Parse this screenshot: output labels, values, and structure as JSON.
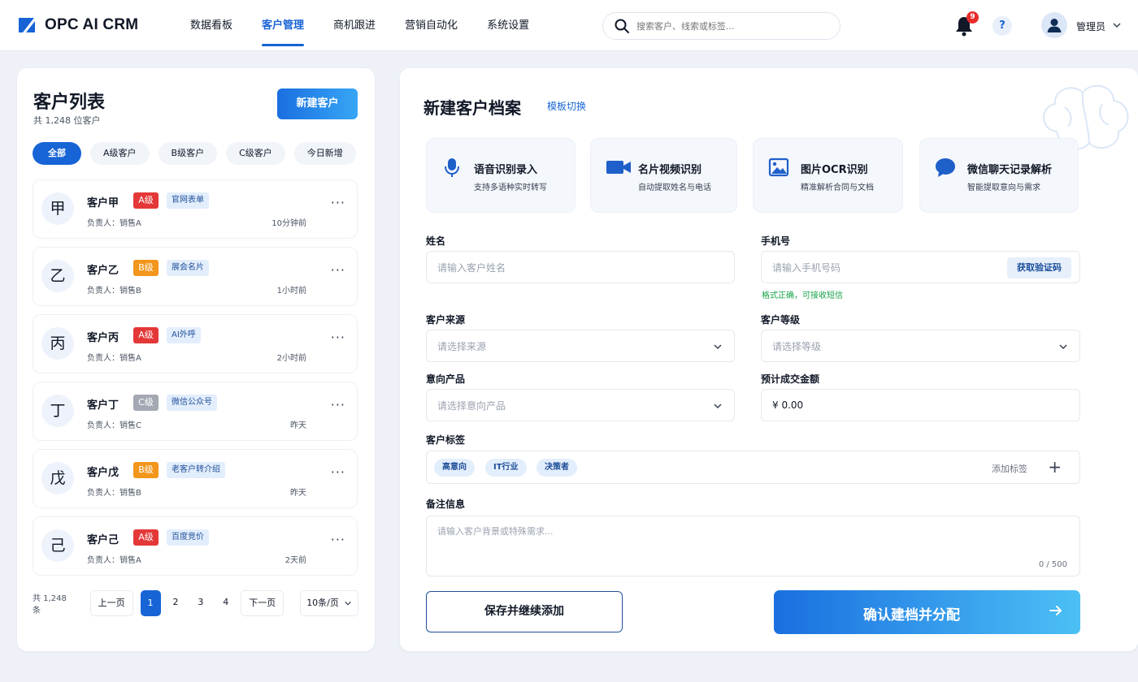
{
  "app": {
    "name": "OPC AI CRM"
  },
  "nav": {
    "items": [
      "数据看板",
      "客户管理",
      "商机跟进",
      "营销自动化",
      "系统设置"
    ],
    "active": 1
  },
  "search": {
    "placeholder": "搜索客户、线索或标签..."
  },
  "notifications": {
    "count": "9"
  },
  "help": {
    "label": "?"
  },
  "user": {
    "name": "管理员"
  },
  "colors": {
    "primary": "#1764d6",
    "level_a": "#e43838",
    "level_b": "#f2961c",
    "level_c": "#a3a8b2",
    "success": "#18a34a"
  },
  "customer_list": {
    "title": "客户列表",
    "subtitle": "共 1,248 位客户",
    "new_button": "新建客户",
    "filters": [
      "全部",
      "A级客户",
      "B级客户",
      "C级客户",
      "今日新增"
    ],
    "active_filter": 0,
    "more_label": "···",
    "items": [
      {
        "avatar": "甲",
        "name": "客户甲",
        "level": "A级",
        "level_key": "a",
        "source": "官网表单",
        "owner": "负责人：销售A",
        "time": "10分钟前"
      },
      {
        "avatar": "乙",
        "name": "客户乙",
        "level": "B级",
        "level_key": "b",
        "source": "展会名片",
        "owner": "负责人：销售B",
        "time": "1小时前"
      },
      {
        "avatar": "丙",
        "name": "客户丙",
        "level": "A级",
        "level_key": "a",
        "source": "AI外呼",
        "owner": "负责人：销售A",
        "time": "2小时前"
      },
      {
        "avatar": "丁",
        "name": "客户丁",
        "level": "C级",
        "level_key": "c",
        "source": "微信公众号",
        "owner": "负责人：销售C",
        "time": "昨天"
      },
      {
        "avatar": "戊",
        "name": "客户戊",
        "level": "B级",
        "level_key": "b",
        "source": "老客户转介绍",
        "owner": "负责人：销售B",
        "time": "昨天"
      },
      {
        "avatar": "己",
        "name": "客户己",
        "level": "A级",
        "level_key": "a",
        "source": "百度竞价",
        "owner": "负责人：销售A",
        "time": "2天前"
      }
    ],
    "pagination": {
      "total": "共 1,248 条",
      "prev": "上一页",
      "pages": [
        "1",
        "2",
        "3",
        "4"
      ],
      "current": "1",
      "next": "下一页",
      "page_size": "10条/页"
    }
  },
  "form": {
    "title": "新建客户档案",
    "template_switch": "模板切换",
    "tools": [
      {
        "icon": "microphone-icon",
        "title": "语音识别录入",
        "subtitle": "支持多语种实时转写"
      },
      {
        "icon": "video-camera-icon",
        "title": "名片视频识别",
        "subtitle": "自动提取姓名与电话"
      },
      {
        "icon": "image-icon",
        "title": "图片OCR识别",
        "subtitle": "精准解析合同与文档"
      },
      {
        "icon": "chat-bubble-icon",
        "title": "微信聊天记录解析",
        "subtitle": "智能提取意向与需求"
      }
    ],
    "name": {
      "label": "姓名",
      "placeholder": "请输入客户姓名"
    },
    "phone": {
      "label": "手机号",
      "placeholder": "请输入手机号码",
      "otp_button": "获取验证码",
      "hint": "格式正确，可接收短信"
    },
    "source": {
      "label": "客户来源",
      "placeholder": "请选择来源"
    },
    "level": {
      "label": "客户等级",
      "placeholder": "请选择等级"
    },
    "product": {
      "label": "意向产品",
      "placeholder": "请选择意向产品"
    },
    "amount": {
      "label": "预计成交金额",
      "value": "¥ 0.00"
    },
    "tags": {
      "label": "客户标签",
      "items": [
        "高意向",
        "IT行业",
        "决策者"
      ],
      "add_label": "添加标签",
      "add_icon": "+"
    },
    "notes": {
      "label": "备注信息",
      "placeholder": "请输入客户背景或特殊需求...",
      "counter": "0 / 500"
    },
    "save_continue": "保存并继续添加",
    "submit": "确认建档并分配"
  }
}
